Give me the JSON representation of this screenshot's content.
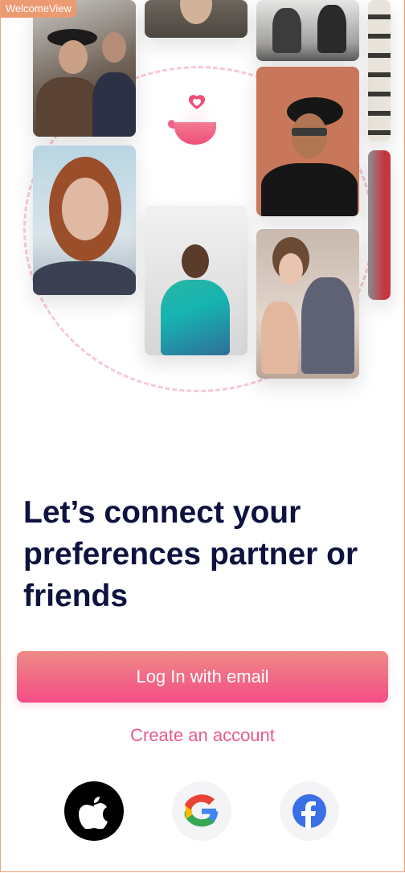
{
  "view_tag": "WelcomeView",
  "headline": "Let’s connect your preferences partner or friends",
  "login_button": "Log In with email",
  "create_account": "Create an account",
  "social": {
    "apple": "apple-icon",
    "google": "google-icon",
    "facebook": "facebook-icon"
  },
  "colors": {
    "primary": "#f44d86",
    "headline": "#0e1240",
    "link": "#e85b88",
    "tag": "#ec9a72"
  }
}
